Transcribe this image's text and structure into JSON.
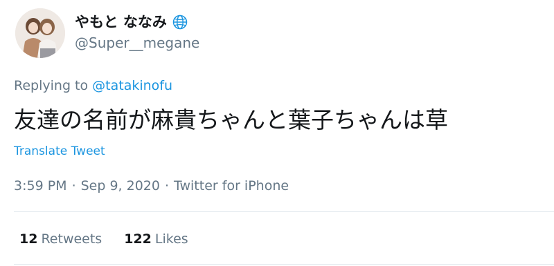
{
  "author": {
    "display_name": "やもと ななみ",
    "handle": "@Super__megane",
    "badge_icon": "globe-icon",
    "avatar_icon": "profile-photo"
  },
  "reply": {
    "prefix": "Replying to",
    "to_handle": "@tatakinofu"
  },
  "tweet": {
    "text": "友達の名前が麻貴ちゃんと葉子ちゃんは草",
    "translate_label": "Translate Tweet"
  },
  "meta": {
    "time": "3:59 PM",
    "date": "Sep 9, 2020",
    "source": "Twitter for iPhone",
    "separator": "·"
  },
  "stats": {
    "retweets_count": "12",
    "retweets_label": "Retweets",
    "likes_count": "122",
    "likes_label": "Likes"
  },
  "colors": {
    "link": "#1b95e0",
    "secondary_text": "#657786",
    "primary_text": "#14171a",
    "divider": "#e1e8ed"
  }
}
